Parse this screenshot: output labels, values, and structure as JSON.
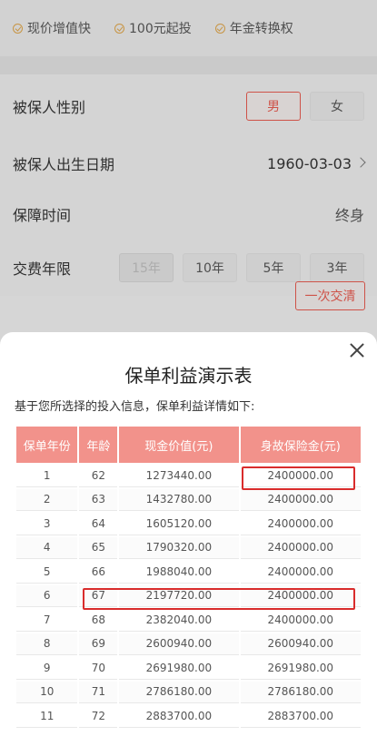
{
  "features": [
    "现价增值快",
    "100元起投",
    "年金转换权"
  ],
  "form": {
    "gender": {
      "label": "被保人性别",
      "options": [
        "男",
        "女"
      ],
      "selected": "男"
    },
    "birth": {
      "label": "被保人出生日期",
      "value": "1960-03-03"
    },
    "period": {
      "label": "保障时间",
      "value": "终身"
    },
    "payment": {
      "label": "交费年限",
      "options": [
        "15年",
        "10年",
        "5年",
        "3年"
      ],
      "disabled": "15年",
      "once_label": "一次交清"
    }
  },
  "modal": {
    "title": "保单利益演示表",
    "subtitle": "基于您所选择的投入信息，保单利益详情如下:",
    "columns": [
      "保单年份",
      "年龄",
      "现金价值(元)",
      "身故保险金(元)"
    ],
    "rows": [
      [
        "1",
        "62",
        "1273440.00",
        "2400000.00"
      ],
      [
        "2",
        "63",
        "1432780.00",
        "2400000.00"
      ],
      [
        "3",
        "64",
        "1605120.00",
        "2400000.00"
      ],
      [
        "4",
        "65",
        "1790320.00",
        "2400000.00"
      ],
      [
        "5",
        "66",
        "1988040.00",
        "2400000.00"
      ],
      [
        "6",
        "67",
        "2197720.00",
        "2400000.00"
      ],
      [
        "7",
        "68",
        "2382040.00",
        "2400000.00"
      ],
      [
        "8",
        "69",
        "2600940.00",
        "2600940.00"
      ],
      [
        "9",
        "70",
        "2691980.00",
        "2691980.00"
      ],
      [
        "10",
        "71",
        "2786180.00",
        "2786180.00"
      ],
      [
        "11",
        "72",
        "2883700.00",
        "2883700.00"
      ]
    ]
  },
  "colors": {
    "accent": "#e05a4f",
    "header_bg": "#f2928b",
    "highlight": "#d92c2c"
  }
}
